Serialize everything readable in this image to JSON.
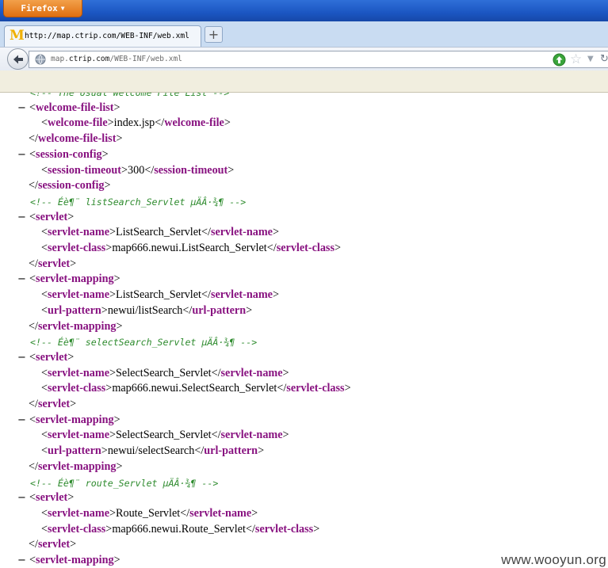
{
  "browser": {
    "menu_button_label": "Firefox",
    "tab_title": "http://map.ctrip.com/WEB-INF/web.xml",
    "tab_favicon": "M",
    "new_tab_label": "+",
    "url_prefix": "map.",
    "url_host": "ctrip.com",
    "url_path": "/WEB-INF/web.xml"
  },
  "icons": {
    "back": "back-arrow-icon",
    "site": "globe-icon",
    "go": "go-arrow-icon",
    "bookmark": "star-icon",
    "history": "dropdown-icon",
    "reload": "reload-icon"
  },
  "colors": {
    "tag": "#881280",
    "comment": "#2e8b2e",
    "titlebar": "#1b56c2",
    "firefox_button": "#e06f10"
  },
  "xml": {
    "lines": [
      {
        "type": "comment",
        "indent": 1,
        "text": "<!-- The Usual Welcome File List -->"
      },
      {
        "type": "open",
        "indent": 1,
        "collapse": true,
        "tag": "welcome-file-list"
      },
      {
        "type": "leaf",
        "indent": 2,
        "tag": "welcome-file",
        "value": "index.jsp"
      },
      {
        "type": "close",
        "indent": 1,
        "tag": "welcome-file-list"
      },
      {
        "type": "open",
        "indent": 1,
        "collapse": true,
        "tag": "session-config"
      },
      {
        "type": "leaf",
        "indent": 2,
        "tag": "session-timeout",
        "value": "300"
      },
      {
        "type": "close",
        "indent": 1,
        "tag": "session-config"
      },
      {
        "type": "comment",
        "indent": 1,
        "text": "<!-- Éè¶¨ listSearch_Servlet µÄÂ·¾¶ -->"
      },
      {
        "type": "open",
        "indent": 1,
        "collapse": true,
        "tag": "servlet"
      },
      {
        "type": "leaf",
        "indent": 2,
        "tag": "servlet-name",
        "value": "ListSearch_Servlet"
      },
      {
        "type": "leaf",
        "indent": 2,
        "tag": "servlet-class",
        "value": "map666.newui.ListSearch_Servlet"
      },
      {
        "type": "close",
        "indent": 1,
        "tag": "servlet"
      },
      {
        "type": "open",
        "indent": 1,
        "collapse": true,
        "tag": "servlet-mapping"
      },
      {
        "type": "leaf",
        "indent": 2,
        "tag": "servlet-name",
        "value": "ListSearch_Servlet"
      },
      {
        "type": "leaf",
        "indent": 2,
        "tag": "url-pattern",
        "value": "newui/listSearch"
      },
      {
        "type": "close",
        "indent": 1,
        "tag": "servlet-mapping"
      },
      {
        "type": "comment",
        "indent": 1,
        "text": "<!-- Éè¶¨ selectSearch_Servlet µÄÂ·¾¶ -->"
      },
      {
        "type": "open",
        "indent": 1,
        "collapse": true,
        "tag": "servlet"
      },
      {
        "type": "leaf",
        "indent": 2,
        "tag": "servlet-name",
        "value": "SelectSearch_Servlet"
      },
      {
        "type": "leaf",
        "indent": 2,
        "tag": "servlet-class",
        "value": "map666.newui.SelectSearch_Servlet"
      },
      {
        "type": "close",
        "indent": 1,
        "tag": "servlet"
      },
      {
        "type": "open",
        "indent": 1,
        "collapse": true,
        "tag": "servlet-mapping"
      },
      {
        "type": "leaf",
        "indent": 2,
        "tag": "servlet-name",
        "value": "SelectSearch_Servlet"
      },
      {
        "type": "leaf",
        "indent": 2,
        "tag": "url-pattern",
        "value": "newui/selectSearch"
      },
      {
        "type": "close",
        "indent": 1,
        "tag": "servlet-mapping"
      },
      {
        "type": "comment",
        "indent": 1,
        "text": "<!-- Éè¶¨ route_Servlet µÄÂ·¾¶ -->"
      },
      {
        "type": "open",
        "indent": 1,
        "collapse": true,
        "tag": "servlet"
      },
      {
        "type": "leaf",
        "indent": 2,
        "tag": "servlet-name",
        "value": "Route_Servlet"
      },
      {
        "type": "leaf",
        "indent": 2,
        "tag": "servlet-class",
        "value": "map666.newui.Route_Servlet"
      },
      {
        "type": "close",
        "indent": 1,
        "tag": "servlet"
      },
      {
        "type": "open",
        "indent": 1,
        "collapse": true,
        "tag": "servlet-mapping"
      }
    ]
  },
  "watermark": "www.wooyun.org"
}
